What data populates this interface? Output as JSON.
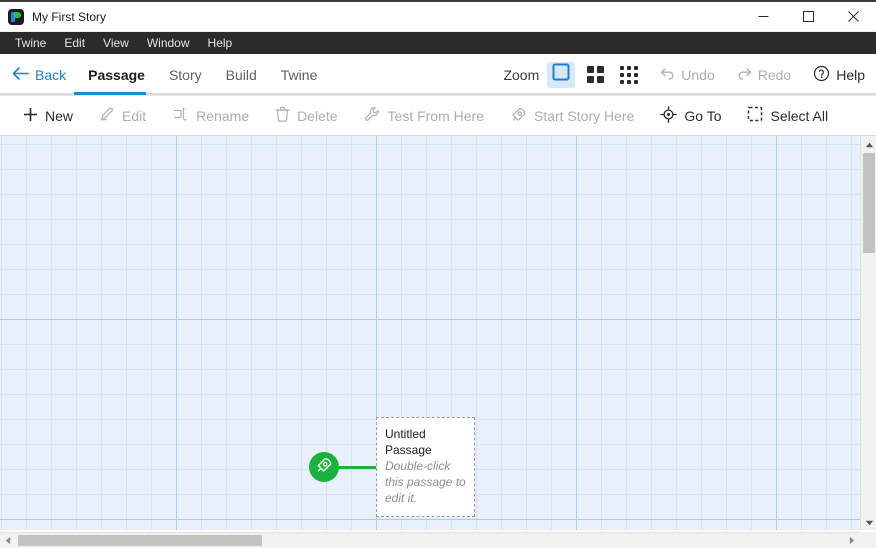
{
  "window": {
    "title": "My First Story",
    "app_icon": "twine-logo-icon",
    "controls": {
      "minimize": "minimize-icon",
      "maximize": "maximize-icon",
      "close": "close-icon"
    }
  },
  "menubar": {
    "items": [
      {
        "label": "Twine"
      },
      {
        "label": "Edit"
      },
      {
        "label": "View"
      },
      {
        "label": "Window"
      },
      {
        "label": "Help"
      }
    ]
  },
  "tabbar": {
    "back_label": "Back",
    "back_icon": "arrow-left-icon",
    "tabs": [
      {
        "label": "Passage",
        "active": true
      },
      {
        "label": "Story",
        "active": false
      },
      {
        "label": "Build",
        "active": false
      },
      {
        "label": "Twine",
        "active": false
      }
    ],
    "zoom": {
      "label": "Zoom",
      "levels": [
        {
          "name": "zoom-large",
          "icon": "single-square-icon",
          "selected": true
        },
        {
          "name": "zoom-medium",
          "icon": "grid-2x2-icon",
          "selected": false
        },
        {
          "name": "zoom-small",
          "icon": "grid-3x3-icon",
          "selected": false
        }
      ]
    },
    "undo": {
      "label": "Undo",
      "icon": "undo-arrow-icon",
      "enabled": false
    },
    "redo": {
      "label": "Redo",
      "icon": "redo-arrow-icon",
      "enabled": false
    },
    "help": {
      "label": "Help",
      "icon": "question-circle-icon",
      "enabled": true
    }
  },
  "actionbar": {
    "actions": [
      {
        "label": "New",
        "icon": "plus-icon",
        "enabled": true
      },
      {
        "label": "Edit",
        "icon": "pencil-icon",
        "enabled": false
      },
      {
        "label": "Rename",
        "icon": "rename-tag-icon",
        "enabled": false
      },
      {
        "label": "Delete",
        "icon": "trash-icon",
        "enabled": false
      },
      {
        "label": "Test From Here",
        "icon": "wrench-icon",
        "enabled": false
      },
      {
        "label": "Start Story Here",
        "icon": "rocket-icon",
        "enabled": false
      },
      {
        "label": "Go To",
        "icon": "target-crosshair-icon",
        "enabled": true
      },
      {
        "label": "Select All",
        "icon": "dashed-square-icon",
        "enabled": true
      }
    ]
  },
  "canvas": {
    "background_color": "#e7f0fb",
    "grid_minor_color": "#d2e4f8",
    "grid_major_color": "#a9cdf0",
    "start_marker": {
      "icon": "rocket-icon",
      "color": "#19b33c"
    },
    "passages": [
      {
        "title": "Untitled Passage",
        "excerpt": "Double-click this passage to edit it.",
        "selected": false
      }
    ]
  },
  "scrollbars": {
    "vertical": {
      "up_icon": "triangle-up-icon",
      "down_icon": "triangle-down-icon"
    },
    "horizontal": {
      "left_icon": "triangle-left-icon",
      "right_icon": "triangle-right-icon"
    }
  },
  "colors": {
    "accent_blue": "#1a8cd8",
    "link_blue": "#1a7fd4",
    "start_green": "#19b33c",
    "menubar_bg": "#2b2b2b"
  }
}
